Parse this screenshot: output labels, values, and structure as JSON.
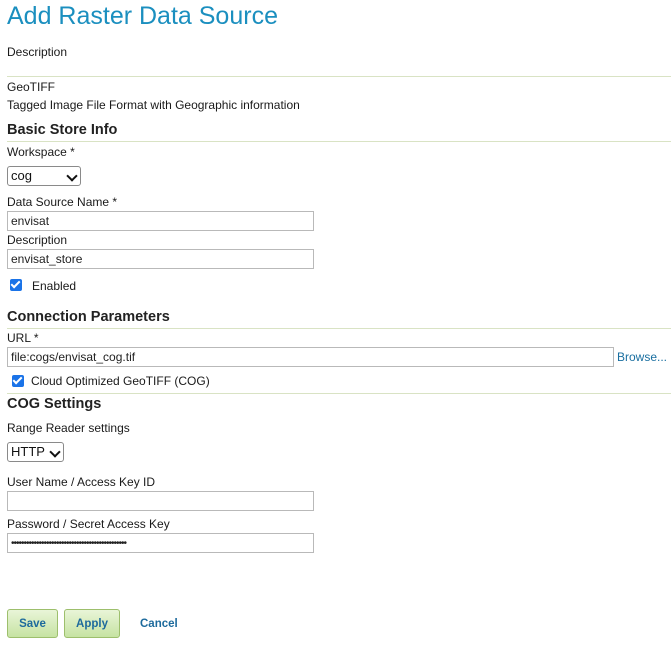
{
  "page": {
    "title": "Add Raster Data Source",
    "description_label": "Description",
    "format_name": "GeoTIFF",
    "format_description": "Tagged Image File Format with Geographic information"
  },
  "basic_store": {
    "heading": "Basic Store Info",
    "workspace_label": "Workspace *",
    "workspace_value": "cog",
    "name_label": "Data Source Name *",
    "name_value": "envisat",
    "description_label": "Description",
    "description_value": "envisat_store",
    "enabled_label": "Enabled",
    "enabled": true
  },
  "connection": {
    "heading": "Connection Parameters",
    "url_label": "URL *",
    "url_value": "file:cogs/envisat_cog.tif",
    "browse_label": "Browse...",
    "cog_label": "Cloud Optimized GeoTIFF (COG)",
    "cog_checked": true
  },
  "cog_settings": {
    "heading": "COG Settings",
    "range_reader_label": "Range Reader settings",
    "range_reader_value": "HTTP",
    "username_label": "User Name / Access Key ID",
    "username_value": "",
    "password_label": "Password / Secret Access Key",
    "password_value": "••••••••••••••••••••••••••••••••••••••••••••••"
  },
  "actions": {
    "save": "Save",
    "apply": "Apply",
    "cancel": "Cancel"
  },
  "colors": {
    "title": "#1b8fbf",
    "button_bg": "#c6e3a2",
    "checkbox": "#1a73e8",
    "link": "#1a6fa0"
  }
}
